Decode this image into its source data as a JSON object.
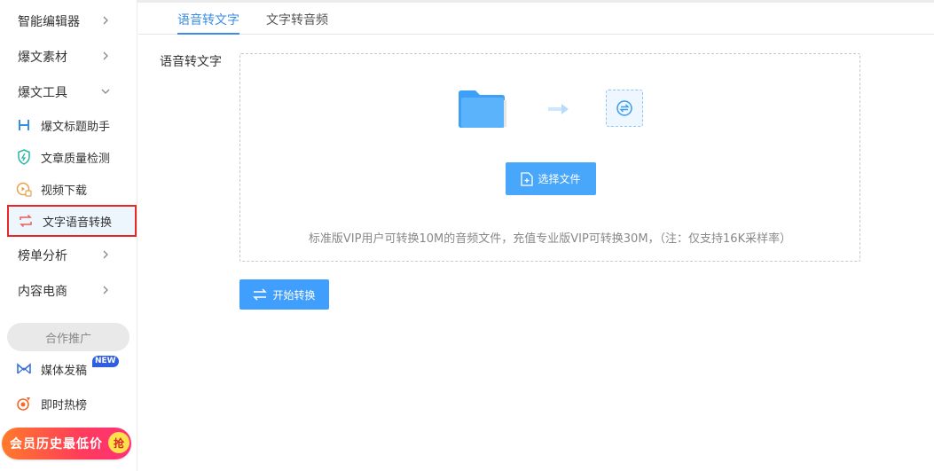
{
  "sidebar": {
    "items": [
      {
        "label": "智能编辑器",
        "expanded": false
      },
      {
        "label": "爆文素材",
        "expanded": false
      },
      {
        "label": "爆文工具",
        "expanded": true
      }
    ],
    "sub_items": [
      {
        "label": "爆文标题助手",
        "icon": "h-letter-icon"
      },
      {
        "label": "文章质量检测",
        "icon": "shield-check-icon"
      },
      {
        "label": "视频下载",
        "icon": "video-download-icon"
      },
      {
        "label": "文字语音转换",
        "icon": "convert-icon",
        "active": true
      }
    ],
    "items_after": [
      {
        "label": "榜单分析"
      },
      {
        "label": "内容电商"
      }
    ],
    "promo_label": "合作推广",
    "promo_items": [
      {
        "label": "媒体发稿",
        "badge": "NEW",
        "icon": "media-m-icon"
      },
      {
        "label": "即时热榜",
        "icon": "fire-target-icon"
      }
    ],
    "vip_banner": {
      "label": "会员历史最低价",
      "action": "抢"
    }
  },
  "tabs": [
    {
      "label": "语音转文字",
      "active": true
    },
    {
      "label": "文字转音频",
      "active": false
    }
  ],
  "form": {
    "label": "语音转文字",
    "select_button": "选择文件",
    "hint": "标准版VIP用户可转换10M的音频文件，充值专业版VIP可转换30M，（注：仅支持16K采样率）",
    "start_button": "开始转换"
  },
  "colors": {
    "accent": "#3a8ee6",
    "button": "#49a7fb",
    "active_border": "#e52929",
    "active_bg": "#eef6fd"
  }
}
